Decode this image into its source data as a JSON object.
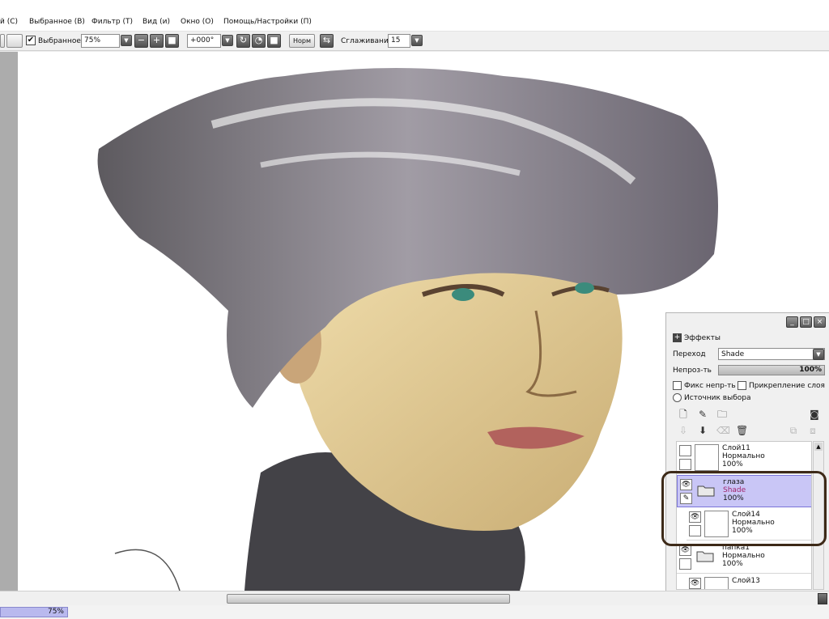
{
  "menu": {
    "items": [
      {
        "label": "й (С)"
      },
      {
        "label": "Выбранное (В)"
      },
      {
        "label": "Фильтр (Т)"
      },
      {
        "label": "Вид (и)"
      },
      {
        "label": "Окно (О)"
      },
      {
        "label": "Помощь/Настройки (П)"
      }
    ]
  },
  "toolbar": {
    "selection_checkbox_label": "Выбранное",
    "selection_checked": true,
    "zoom_value": "75%",
    "rotation_value": "+000°",
    "mode_button": "Норм",
    "smoothing_label": "Сглаживание",
    "smoothing_value": "15"
  },
  "canvas": {
    "description_icon": "portrait-artwork"
  },
  "layer_panel": {
    "effects_label": "Эффекты",
    "blend_label": "Переход",
    "blend_value": "Shade",
    "opacity_label": "Непроз-ть",
    "opacity_value": "100%",
    "opacity_level": 1.0,
    "fix_opacity_label": "Фикс непр-ть",
    "clip_label": "Прикрепление слоя",
    "source_label": "Источник выбора",
    "layers": [
      {
        "name": "Слой11",
        "mode": "Нормально",
        "opacity": "100%"
      },
      {
        "name": "глаза",
        "mode": "Shade",
        "opacity": "100%",
        "selected": true,
        "type": "folder"
      },
      {
        "name": "Слой14",
        "mode": "Нормально",
        "opacity": "100%",
        "child": true
      },
      {
        "name": "папка1",
        "mode": "Нормально",
        "opacity": "100%",
        "type": "folder"
      },
      {
        "name": "Слой13"
      }
    ]
  },
  "status": {
    "zoom": "75%"
  },
  "colors": {
    "selected_layer": "#c9c6f6",
    "shade_mode_text": "#a0256e",
    "annotation": "#3d2a18"
  }
}
